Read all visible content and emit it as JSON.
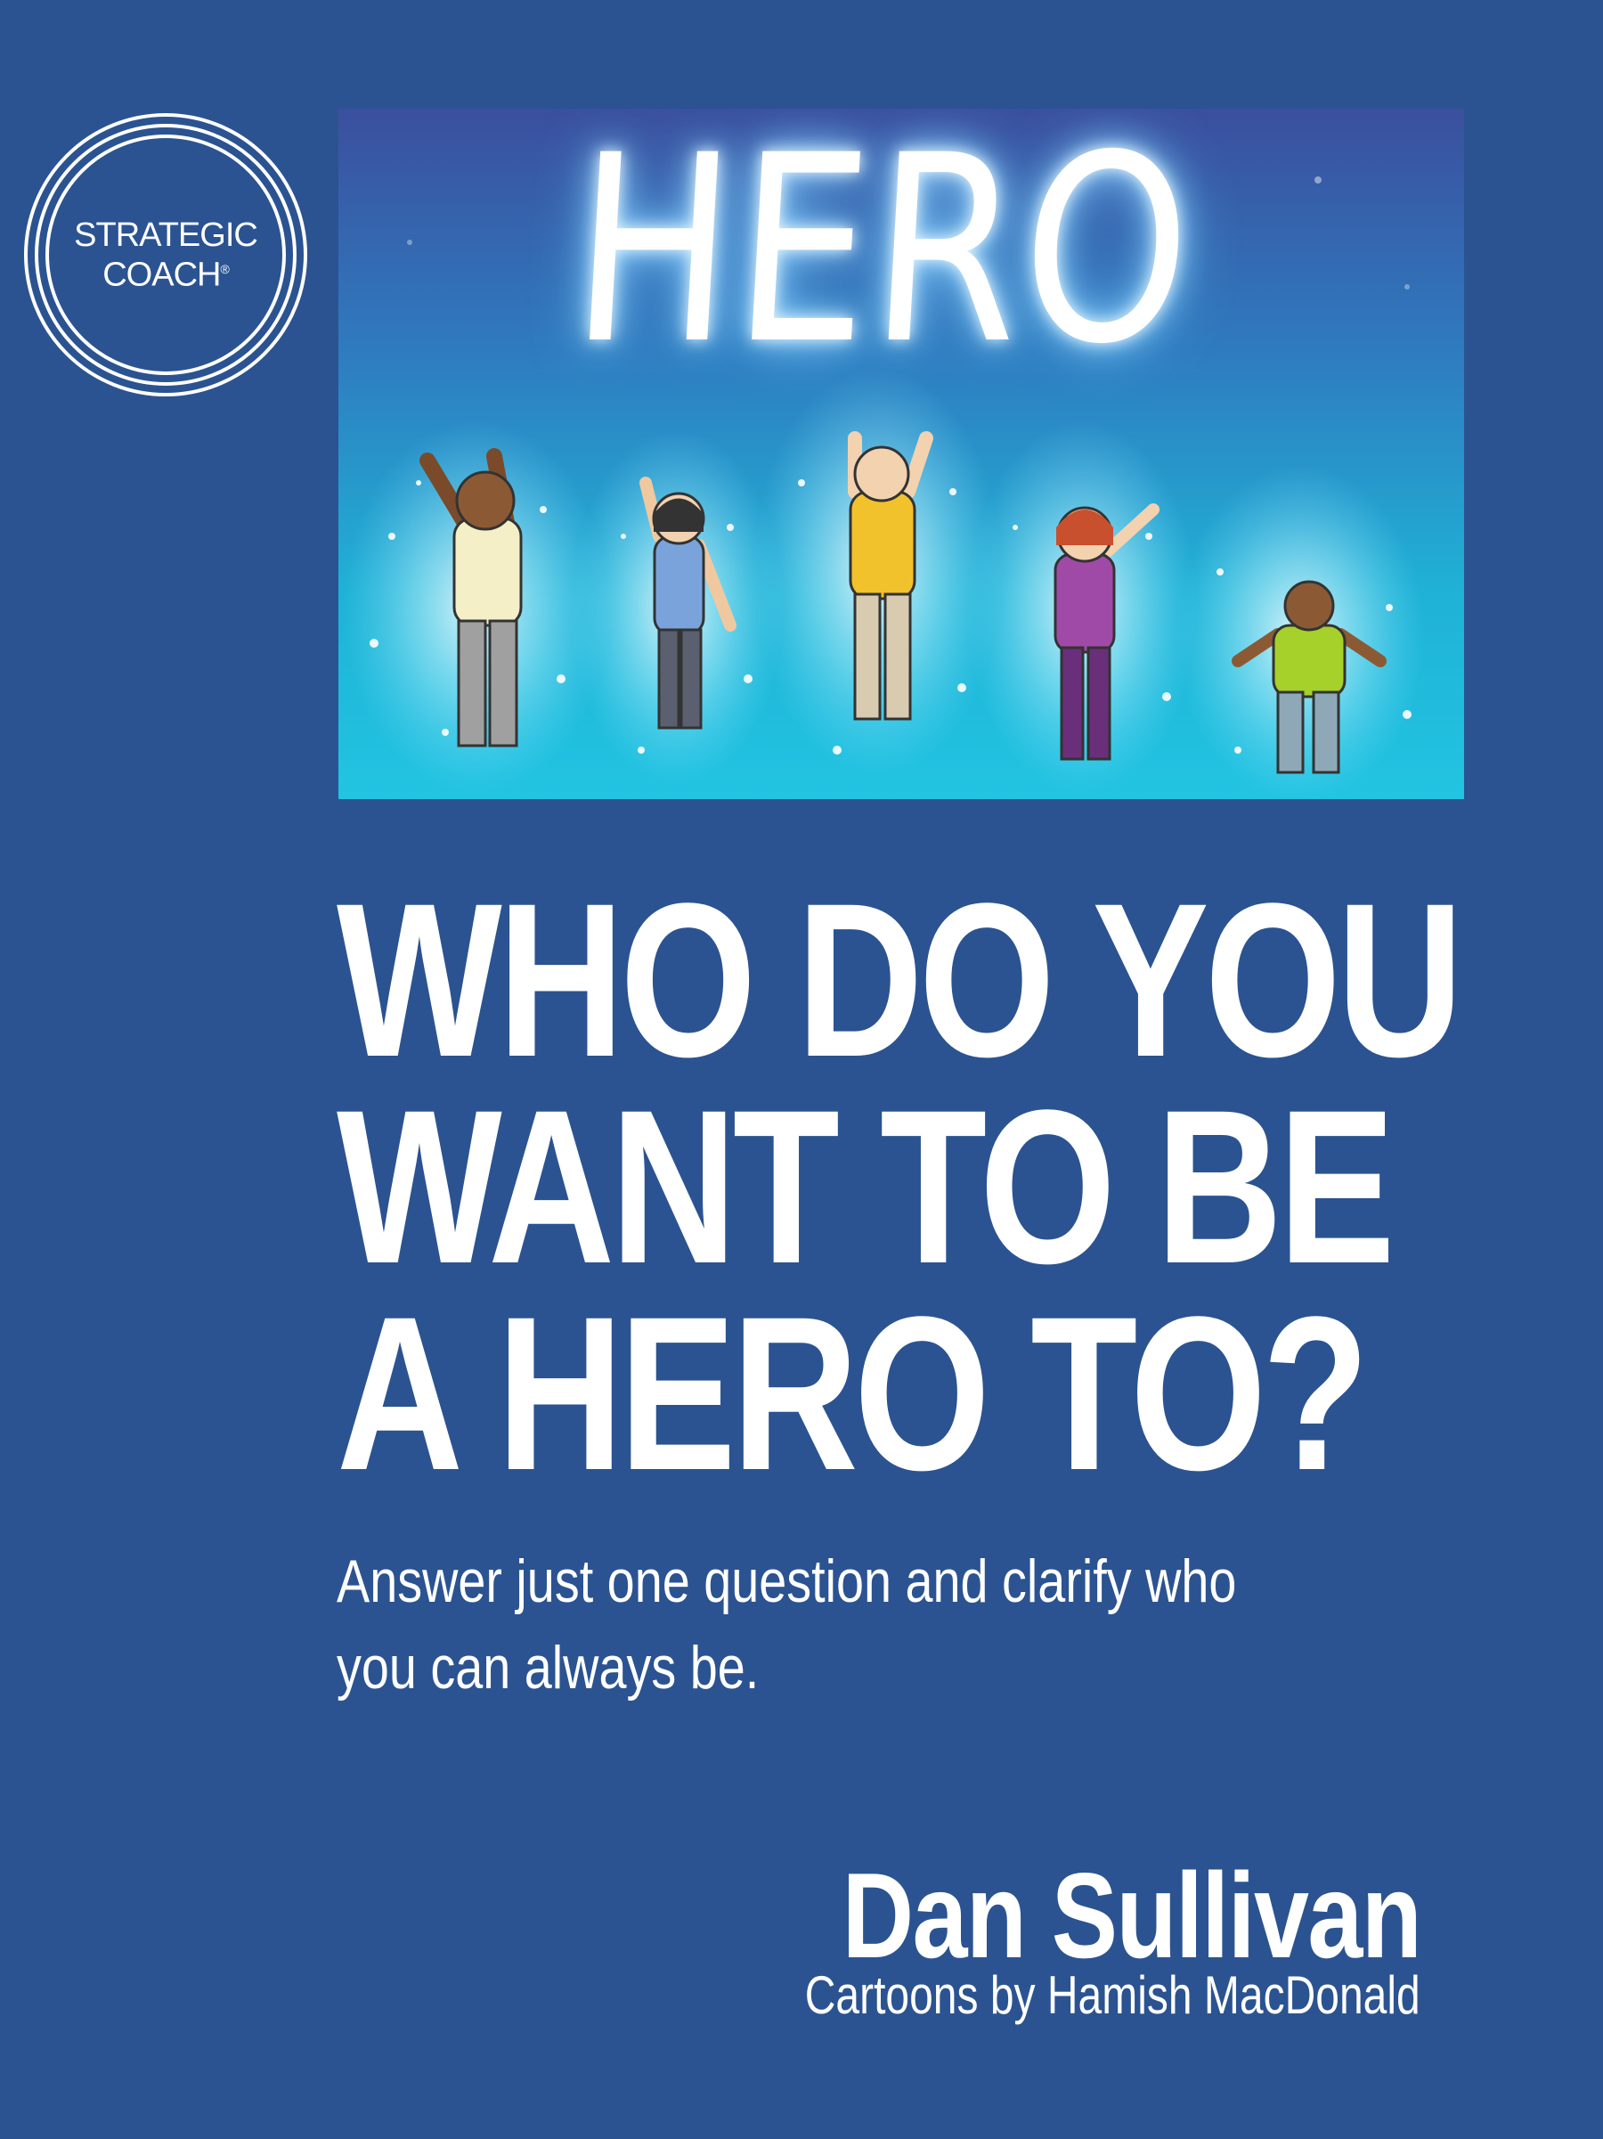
{
  "logo": {
    "line1": "STRATEGIC",
    "line2": "COACH",
    "mark": "®"
  },
  "illustration": {
    "word": "HERO",
    "icon": "cartoon-jumping-people-illustration"
  },
  "headline": {
    "line1": "WHO DO YOU",
    "line2": "WANT TO BE",
    "line3": "A HERO TO?"
  },
  "subtitle": {
    "line1": "Answer just one question and clarify who",
    "line2": "you can always be."
  },
  "author": "Dan Sullivan",
  "credit": "Cartoons by Hamish MacDonald",
  "colors": {
    "background": "#2b5391",
    "text": "#ffffff",
    "sky_top": "#3a4a9a",
    "sky_bottom": "#1fb4d8"
  }
}
